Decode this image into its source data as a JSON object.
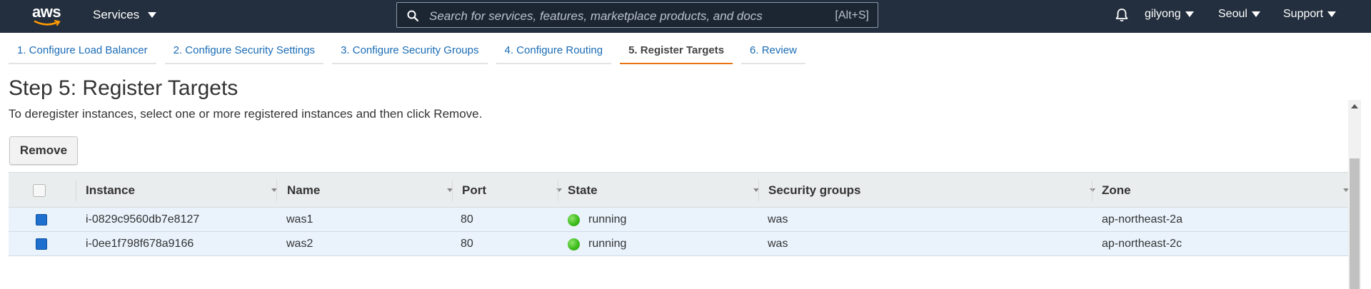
{
  "topnav": {
    "logo_text": "aws",
    "services_label": "Services",
    "search_placeholder": "Search for services, features, marketplace products, and docs",
    "search_shortcut": "[Alt+S]",
    "user": "gilyong",
    "region": "Seoul",
    "support": "Support",
    "bg_color": "#232f3e"
  },
  "tabs": [
    {
      "label": "1. Configure Load Balancer"
    },
    {
      "label": "2. Configure Security Settings"
    },
    {
      "label": "3. Configure Security Groups"
    },
    {
      "label": "4. Configure Routing"
    },
    {
      "label": "5. Register Targets"
    },
    {
      "label": "6. Review"
    }
  ],
  "active_tab_color": "#ec7211",
  "page": {
    "title": "Step 5: Register Targets",
    "description": "To deregister instances, select one or more registered instances and then click Remove.",
    "remove_label": "Remove"
  },
  "table": {
    "columns": [
      "Instance",
      "Name",
      "Port",
      "State",
      "Security groups",
      "Zone"
    ],
    "rows": [
      {
        "instance": "i-0829c9560db7e8127",
        "name": "was1",
        "port": "80",
        "state": "running",
        "security_groups": "was",
        "zone": "ap-northeast-2a",
        "selected": true
      },
      {
        "instance": "i-0ee1f798f678a9166",
        "name": "was2",
        "port": "80",
        "state": "running",
        "security_groups": "was",
        "zone": "ap-northeast-2c",
        "selected": true
      }
    ]
  }
}
